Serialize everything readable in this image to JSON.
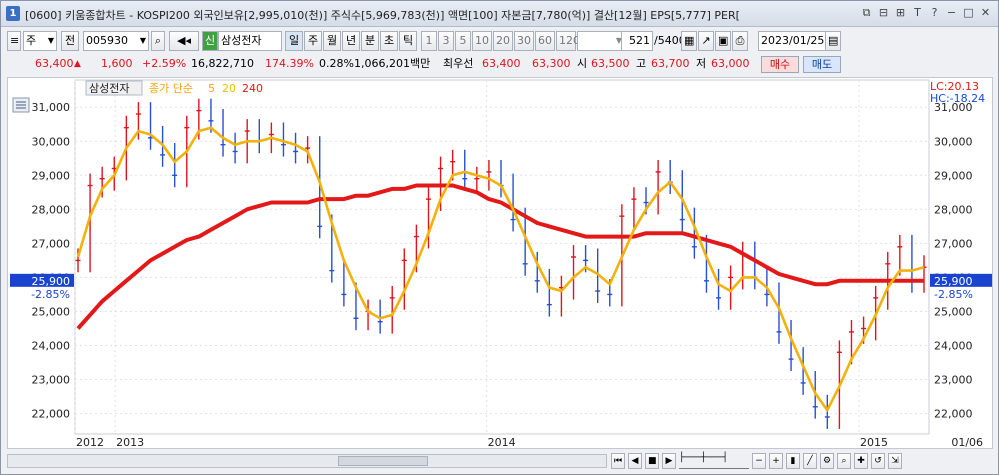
{
  "window": {
    "title": "[0600] 키움종합차트 - KOSPI200 외국인보유[2,995,010(천)] 주식수[5,969,783(천)] 액면[100] 자본금[7,780(억)] 결산[12월] EPS[5,777] PER[",
    "app_icon": "1"
  },
  "toolbar": {
    "period_select": "주",
    "prev_label": "전",
    "code": "005930",
    "stock_badge": "신",
    "stock_name": "삼성전자",
    "periods": [
      "일",
      "주",
      "월",
      "년",
      "분",
      "초",
      "틱"
    ],
    "active_period": "일",
    "intervals": [
      "1",
      "3",
      "5",
      "10",
      "20",
      "30",
      "60",
      "120"
    ],
    "count": "521",
    "count_total": "/5400",
    "date": "2023/01/25"
  },
  "quote": {
    "price": "63,400",
    "change": "1,600",
    "change_pct": "+2.59%",
    "volume": "16,822,710",
    "volume_ratio": "174.39%",
    "turnover_pct": "0.28%",
    "amount": "1,066,201백만",
    "best_ask_label": "최우선",
    "best_ask": "63,400",
    "best_bid": "63,300",
    "open_label": "시",
    "open": "63,500",
    "high_label": "고",
    "high": "63,700",
    "low_label": "저",
    "low": "63,000",
    "buy_label": "매수",
    "sell_label": "매도"
  },
  "chart_data": {
    "type": "line",
    "title": "삼성전자",
    "legend": {
      "price_label": "종가 단순",
      "ma_periods": [
        "5",
        "20",
        "240"
      ]
    },
    "lc_label": "LC:20.13",
    "hc_label": "HC:-18.24",
    "current_value": "25,900",
    "current_change": "-2.85%",
    "y_ticks": [
      "31,000",
      "30,000",
      "29,000",
      "28,000",
      "27,000",
      "26,000",
      "25,000",
      "24,000",
      "23,000",
      "22,000"
    ],
    "x_labels": [
      "2012",
      "2013",
      "2014",
      "2015",
      "01/06"
    ],
    "ylim": [
      21400,
      31800
    ],
    "x": [
      0,
      2,
      4,
      6,
      8,
      10,
      12,
      14,
      16,
      18,
      20,
      22,
      24,
      26,
      28,
      30,
      32,
      34,
      36,
      38,
      40,
      42,
      44,
      46,
      48,
      50,
      52,
      54,
      56,
      58,
      60,
      62,
      64,
      66,
      68,
      70,
      72,
      74,
      76,
      78,
      80,
      82,
      84,
      86,
      88,
      90,
      92,
      94,
      96,
      98,
      100,
      102,
      104,
      106,
      108,
      110,
      112,
      114,
      116,
      118,
      120,
      122,
      124,
      126,
      128,
      130,
      132,
      134,
      136,
      138,
      140
    ],
    "close": [
      26500,
      28700,
      28900,
      29200,
      30400,
      30800,
      30100,
      29600,
      29000,
      30400,
      30900,
      30600,
      29900,
      29700,
      30300,
      30000,
      30200,
      29900,
      29700,
      29800,
      27500,
      26200,
      25500,
      24800,
      25000,
      24700,
      25400,
      26500,
      27200,
      28300,
      29200,
      29400,
      28900,
      28900,
      29100,
      28700,
      27700,
      26400,
      25900,
      25200,
      25700,
      26600,
      26500,
      25600,
      25500,
      27800,
      28300,
      28200,
      29100,
      28800,
      27700,
      26900,
      25900,
      25400,
      26000,
      26700,
      26000,
      25500,
      24400,
      23600,
      22900,
      22200,
      21900,
      23800,
      24400,
      24500,
      25400,
      26400,
      26900,
      25900,
      26300
    ],
    "ma5": [
      26600,
      27800,
      28600,
      29000,
      29800,
      30300,
      30200,
      29900,
      29400,
      29700,
      30300,
      30400,
      30100,
      29900,
      30000,
      30000,
      30100,
      30000,
      29900,
      29700,
      28800,
      27600,
      26500,
      25700,
      25000,
      24800,
      24900,
      25600,
      26400,
      27300,
      28300,
      29000,
      29100,
      29000,
      28900,
      28700,
      28000,
      27200,
      26400,
      25700,
      25600,
      26000,
      26300,
      26100,
      25800,
      26600,
      27400,
      28000,
      28500,
      28800,
      28300,
      27500,
      26600,
      25800,
      25600,
      26000,
      26000,
      25700,
      25100,
      24200,
      23400,
      22600,
      22100,
      22800,
      23600,
      24200,
      24900,
      25700,
      26200,
      26200,
      26300
    ],
    "ma240": [
      24500,
      24900,
      25300,
      25600,
      25900,
      26200,
      26500,
      26700,
      26900,
      27100,
      27200,
      27400,
      27600,
      27800,
      28000,
      28100,
      28200,
      28200,
      28200,
      28200,
      28300,
      28300,
      28300,
      28400,
      28400,
      28500,
      28600,
      28600,
      28700,
      28700,
      28700,
      28700,
      28600,
      28500,
      28300,
      28200,
      28000,
      27800,
      27600,
      27500,
      27400,
      27300,
      27200,
      27200,
      27200,
      27200,
      27200,
      27300,
      27300,
      27300,
      27300,
      27200,
      27100,
      27000,
      26900,
      26700,
      26500,
      26300,
      26100,
      26000,
      25900,
      25800,
      25800,
      25900,
      25900,
      25900,
      25900,
      25900,
      25900,
      25900,
      25900
    ]
  },
  "colors": {
    "price": "#2a4fd0",
    "up": "#e0141e",
    "ma5": "#f2b20a",
    "ma240": "#e31818"
  },
  "icons": [
    "notes-icon",
    "restore-icon",
    "window-icon",
    "font-size-icon",
    "help-icon",
    "minimize-icon",
    "maximize-icon",
    "close-icon"
  ]
}
